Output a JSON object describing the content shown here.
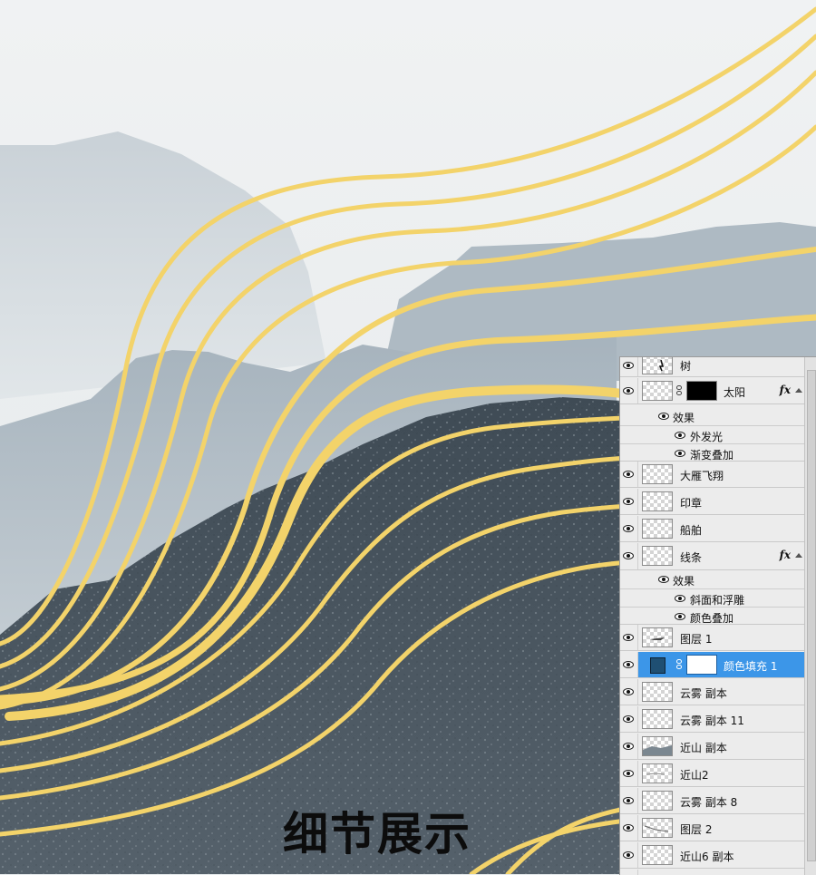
{
  "caption": "细节展示",
  "colors": {
    "gold_line": "#f5d76b",
    "dark_mountain": "#4a5660",
    "sky": "#eef1f2",
    "selection": "#3c96e8"
  },
  "layers": [
    {
      "name": "树",
      "visible": true,
      "thumb": "tree-silhouette",
      "partial": true
    },
    {
      "name": "太阳",
      "visible": true,
      "has_mask": true,
      "mask_color": "#000000",
      "fx": "fx",
      "expandable": true,
      "effects_label": "效果",
      "effects": [
        "外发光",
        "渐变叠加"
      ]
    },
    {
      "name": "大雁飞翔",
      "visible": true
    },
    {
      "name": "印章",
      "visible": true
    },
    {
      "name": "船舶",
      "visible": true
    },
    {
      "name": "线条",
      "visible": true,
      "fx": "fx",
      "expandable": true,
      "effects_label": "效果",
      "effects": [
        "斜面和浮雕",
        "颜色叠加"
      ]
    },
    {
      "name": "图层 1",
      "visible": true
    },
    {
      "name": "颜色填充 1",
      "visible": true,
      "selected": true,
      "fill_color": "#1f4f73",
      "has_mask": true,
      "mask_color": "#ffffff"
    },
    {
      "name": "云雾 副本",
      "visible": true
    },
    {
      "name": "云雾 副本 11",
      "visible": true
    },
    {
      "name": "近山 副本",
      "visible": true
    },
    {
      "name": "近山2",
      "visible": true
    },
    {
      "name": "云雾 副本 8",
      "visible": true
    },
    {
      "name": "图层 2",
      "visible": true
    },
    {
      "name": "近山6 副本",
      "visible": true
    }
  ]
}
